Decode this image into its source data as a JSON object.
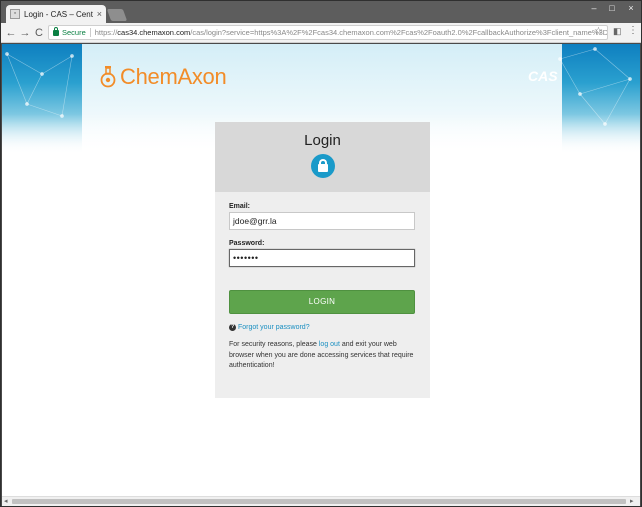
{
  "browser": {
    "tab_title": "Login - CAS – Cent",
    "tab_close": "×",
    "window_controls": [
      "–",
      "□",
      "×"
    ],
    "nav": {
      "back": "←",
      "forward": "→",
      "reload": "C"
    },
    "secure_label": "Secure",
    "url_scheme": "https://",
    "url_host": "cas34.chemaxon.com",
    "url_rest": "/cas/login?service=https%3A%2F%2Fcas34.chemaxon.com%2Fcas%2Foauth2.0%2FcallbackAuthorize%3Fclient_name%3DCasOAuth",
    "star_icon": "☆"
  },
  "header": {
    "brand": "ChemAxon",
    "cas_logo": "CAS"
  },
  "login": {
    "title": "Login",
    "email_label": "Email:",
    "email_value": "jdoe@grr.la",
    "password_label": "Password:",
    "password_value": "•••••••",
    "submit_label": "LOGIN",
    "forgot_link": "Forgot your password?",
    "notice_before": "For security reasons, please ",
    "notice_link": "log out",
    "notice_after": " and exit your web browser when you are done accessing services that require authentication!"
  },
  "colors": {
    "brand_orange": "#f28c28",
    "lock_blue": "#1a9ac9",
    "login_green": "#5ea44c",
    "link_blue": "#1a8fc1"
  },
  "icons": [
    "favicon-icon",
    "lock-icon",
    "star-icon",
    "extension-icon",
    "menu-icon",
    "flask-icon",
    "help-icon"
  ]
}
